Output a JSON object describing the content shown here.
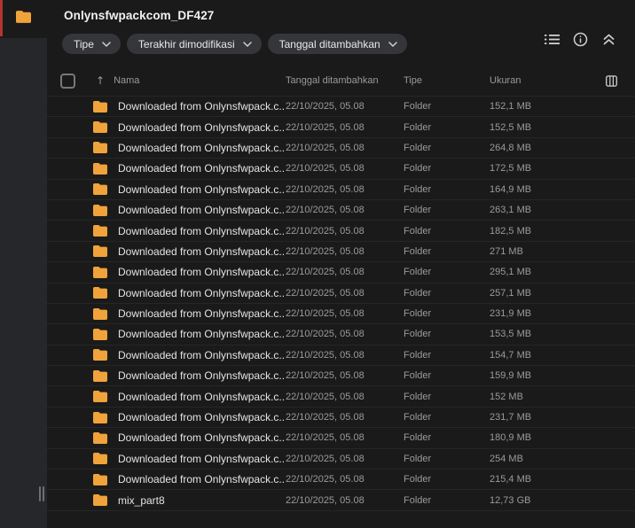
{
  "window": {
    "title": "Onlynsfwpackcom_DF427"
  },
  "sidebar": {
    "icons": [
      "folder-icon"
    ],
    "has_accent_strip": true
  },
  "toolbar": {
    "chips": [
      {
        "label": "Tipe"
      },
      {
        "label": "Terakhir dimodifikasi"
      },
      {
        "label": "Tanggal ditambahkan"
      }
    ],
    "icons": [
      "list-view-icon",
      "info-icon",
      "collapse-icon"
    ]
  },
  "table": {
    "columns": {
      "name": "Nama",
      "date_added": "Tanggal ditambahkan",
      "type": "Tipe",
      "size": "Ukuran"
    },
    "sort": {
      "column": "Nama",
      "direction": "ascending"
    },
    "rows": [
      {
        "name": "Downloaded from Onlynsfwpack.c...",
        "date_added": "22/10/2025, 05.08",
        "type": "Folder",
        "size": "152,1 MB"
      },
      {
        "name": "Downloaded from Onlynsfwpack.c...",
        "date_added": "22/10/2025, 05.08",
        "type": "Folder",
        "size": "152,5 MB"
      },
      {
        "name": "Downloaded from Onlynsfwpack.c...",
        "date_added": "22/10/2025, 05.08",
        "type": "Folder",
        "size": "264,8 MB"
      },
      {
        "name": "Downloaded from Onlynsfwpack.c...",
        "date_added": "22/10/2025, 05.08",
        "type": "Folder",
        "size": "172,5 MB"
      },
      {
        "name": "Downloaded from Onlynsfwpack.c...",
        "date_added": "22/10/2025, 05.08",
        "type": "Folder",
        "size": "164,9 MB"
      },
      {
        "name": "Downloaded from Onlynsfwpack.c...",
        "date_added": "22/10/2025, 05.08",
        "type": "Folder",
        "size": "263,1 MB"
      },
      {
        "name": "Downloaded from Onlynsfwpack.c...",
        "date_added": "22/10/2025, 05.08",
        "type": "Folder",
        "size": "182,5 MB"
      },
      {
        "name": "Downloaded from Onlynsfwpack.c...",
        "date_added": "22/10/2025, 05.08",
        "type": "Folder",
        "size": "271 MB"
      },
      {
        "name": "Downloaded from Onlynsfwpack.c...",
        "date_added": "22/10/2025, 05.08",
        "type": "Folder",
        "size": "295,1 MB"
      },
      {
        "name": "Downloaded from Onlynsfwpack.c...",
        "date_added": "22/10/2025, 05.08",
        "type": "Folder",
        "size": "257,1 MB"
      },
      {
        "name": "Downloaded from Onlynsfwpack.c...",
        "date_added": "22/10/2025, 05.08",
        "type": "Folder",
        "size": "231,9 MB"
      },
      {
        "name": "Downloaded from Onlynsfwpack.c...",
        "date_added": "22/10/2025, 05.08",
        "type": "Folder",
        "size": "153,5 MB"
      },
      {
        "name": "Downloaded from Onlynsfwpack.c...",
        "date_added": "22/10/2025, 05.08",
        "type": "Folder",
        "size": "154,7 MB"
      },
      {
        "name": "Downloaded from Onlynsfwpack.c...",
        "date_added": "22/10/2025, 05.08",
        "type": "Folder",
        "size": "159,9 MB"
      },
      {
        "name": "Downloaded from Onlynsfwpack.c...",
        "date_added": "22/10/2025, 05.08",
        "type": "Folder",
        "size": "152 MB"
      },
      {
        "name": "Downloaded from Onlynsfwpack.c...",
        "date_added": "22/10/2025, 05.08",
        "type": "Folder",
        "size": "231,7 MB"
      },
      {
        "name": "Downloaded from Onlynsfwpack.c...",
        "date_added": "22/10/2025, 05.08",
        "type": "Folder",
        "size": "180,9 MB"
      },
      {
        "name": "Downloaded from Onlynsfwpack.c...",
        "date_added": "22/10/2025, 05.08",
        "type": "Folder",
        "size": "254 MB"
      },
      {
        "name": "Downloaded from Onlynsfwpack.c...",
        "date_added": "22/10/2025, 05.08",
        "type": "Folder",
        "size": "215,4 MB"
      },
      {
        "name": "mix_part8",
        "date_added": "22/10/2025, 05.08",
        "type": "Folder",
        "size": "12,73 GB"
      }
    ]
  },
  "colors": {
    "background": "#1A1A1A",
    "sidebar": "#26272A",
    "chip": "#35363A",
    "folder": "#F0A33A",
    "accent_strip": "#B4342E",
    "secondary_text": "#9A9A9A"
  }
}
